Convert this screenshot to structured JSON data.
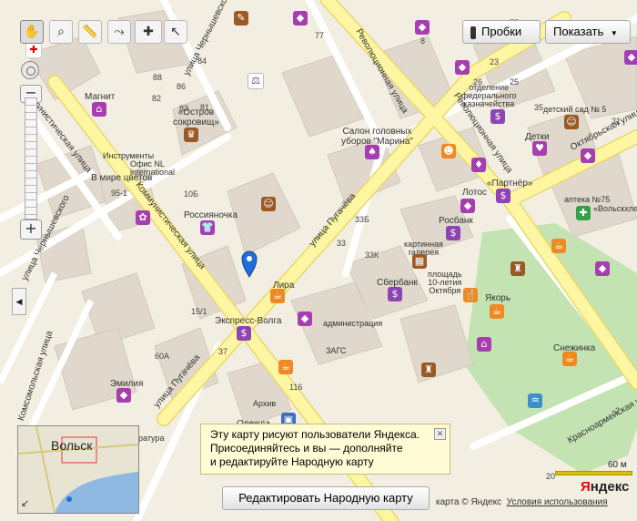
{
  "toolbar": {
    "tools": [
      {
        "name": "hand-tool",
        "icon": "hand-icon",
        "glyph": "✋"
      },
      {
        "name": "zoom-area-tool",
        "icon": "magnifier-icon",
        "glyph": "⌕"
      },
      {
        "name": "ruler-tool",
        "icon": "ruler-icon",
        "glyph": "📏"
      },
      {
        "name": "route-tool",
        "icon": "route-icon",
        "glyph": "⤳"
      },
      {
        "name": "add-placemark-tool",
        "icon": "placemark-icon",
        "glyph": "✚"
      },
      {
        "name": "select-tool",
        "icon": "cursor-icon",
        "glyph": "↖"
      }
    ],
    "traffic_label": "Пробки",
    "show_label": "Показать",
    "show_arrow": "▼"
  },
  "zoom": {
    "plus": "+",
    "minus": "−",
    "level_fraction": 0.97
  },
  "streets": {
    "chernyshevskogo_top": "улица Чернышевского",
    "chernyshevskogo_left": "улица Чернышевского",
    "revolyutsionnaya_top": "Революционная улица",
    "revolyutsionnaya_mid": "Революционная улица",
    "kommunisticheskaya_top": "Коммунистическая улица",
    "kommunisticheskaya_mid": "Коммунистическая улица",
    "pugacheva_top": "улица Пугачёва",
    "pugacheva_bottom": "улица Пугачёва",
    "oktyabrskaya": "Октябрьская улица",
    "komsomolskaya": "Комсомольская улица",
    "krasnoarmeyskaya": "Красноармейская улица"
  },
  "labels": {
    "magnit": "Магнит",
    "ostrov": "«Остров",
    "ostrov2": "сокровищ»",
    "instrumenty": "Инструменты",
    "ofis": "Офис NL",
    "international": "international",
    "v_mire_tsvetov": "В мире цветов",
    "rossiyanochka": "Россияночка",
    "salon": "Салон головных",
    "salon2": "уборов \"Марина\"",
    "otdelenie": "отделение",
    "otdelenie2": "федерального",
    "otdelenie3": "казначейства",
    "detsky_sad": "детский сад № 5",
    "detki": "Детки",
    "partner": "«Партнёр»",
    "apteka": "аптека №75",
    "volskhleb": "«Вольскхлеб»",
    "lotos": "Лотос",
    "rosbank": "Росбанк",
    "kartinnaya": "картинная",
    "galereya": "галерея",
    "ploshad": "площадь",
    "ploshad2": "10-летия",
    "ploshad3": "Октября",
    "sberbank": "Сбербанк",
    "lira": "Лира",
    "yakor": "Якорь",
    "ekspress_volga": "Экспресс-Волга",
    "administratsiya": "администрация",
    "zags": "ЗАГС",
    "snezhinka": "Снежинка",
    "emiliya": "Эмилия",
    "arkhiv": "Архив",
    "odezhda": "Одежда",
    "ratura": "ратура"
  },
  "house_numbers": [
    "77",
    "84",
    "88",
    "86",
    "83",
    "81",
    "82",
    "8",
    "23",
    "25",
    "26",
    "75",
    "35",
    "10Б",
    "95-1",
    "33Б",
    "33",
    "33К",
    "15/1",
    "37",
    "60А",
    "116",
    "21",
    "2",
    "20"
  ],
  "popup": {
    "text": "Эту карту рисуют пользователи Яндекса. Присоединяйтесь и вы — дополняйте и редактируйте Народную карту",
    "line1": "Эту карту рисуют пользователи Яндекса.",
    "line2": "Присоединяйтесь и вы — дополняйте",
    "line3": "и редактируйте Народную карту",
    "close": "✕"
  },
  "edit_button": "Редактировать Народную карту",
  "minimap": {
    "city": "Вольск",
    "expand_icon": "↙"
  },
  "scale": {
    "label": "60 м"
  },
  "logo": {
    "first": "Я",
    "rest": "ндекс"
  },
  "attribution": {
    "text": "карта © Яндекс",
    "terms": "Условия использования"
  },
  "colors": {
    "land": "#f2eee2",
    "road": "#ffffff",
    "main_road": "#fff6a3",
    "building": "#e0d8cc",
    "park": "#c4e3b2",
    "shop_poi": "#a63eb1",
    "bank_poi": "#8e44b5",
    "food_poi": "#ef8a23",
    "culture_poi": "#9a5a26",
    "kids_poi": "#b53a8a",
    "medical_poi": "#33a048"
  }
}
